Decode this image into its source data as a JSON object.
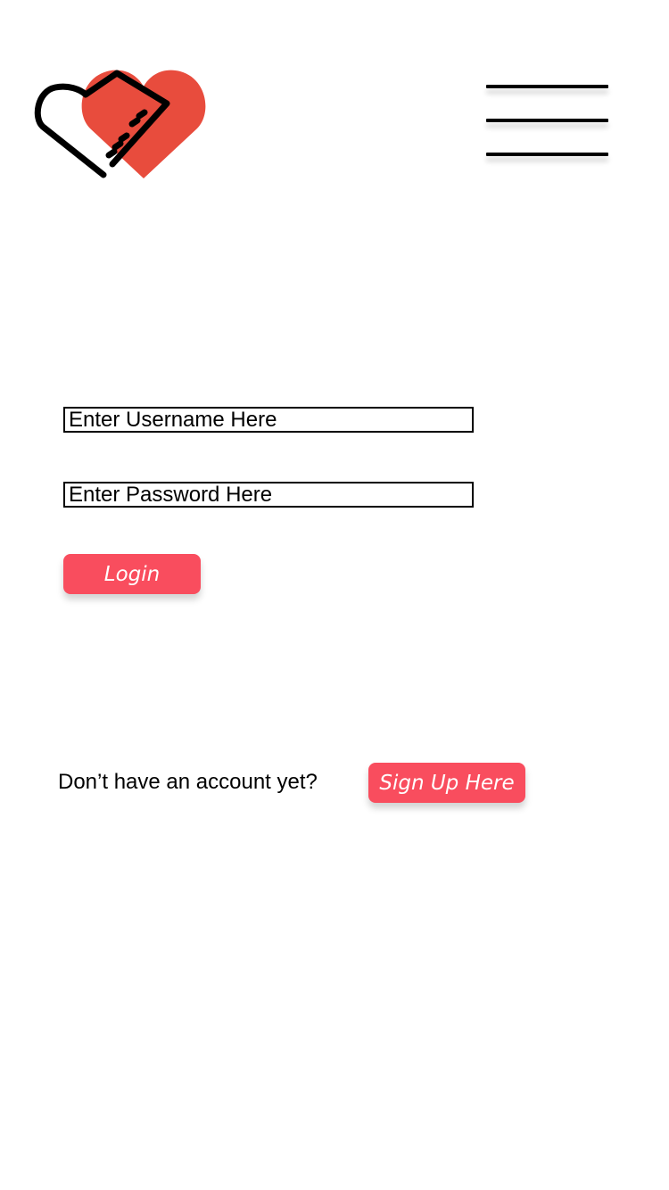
{
  "header": {
    "logo_icon": "piano-heart-logo-icon",
    "menu_icon": "hamburger-menu-icon",
    "colors": {
      "logo_heart": "#E84C3D",
      "logo_outline": "#000000"
    }
  },
  "login_form": {
    "username_placeholder": "Enter Username Here",
    "password_placeholder": "Enter Password Here",
    "login_label": "Login"
  },
  "signup": {
    "prompt": "Don’t have an account yet?",
    "button_label": "Sign Up Here"
  },
  "colors": {
    "accent": "#F94D5E",
    "background": "#FFFFFF",
    "text": "#000000"
  }
}
